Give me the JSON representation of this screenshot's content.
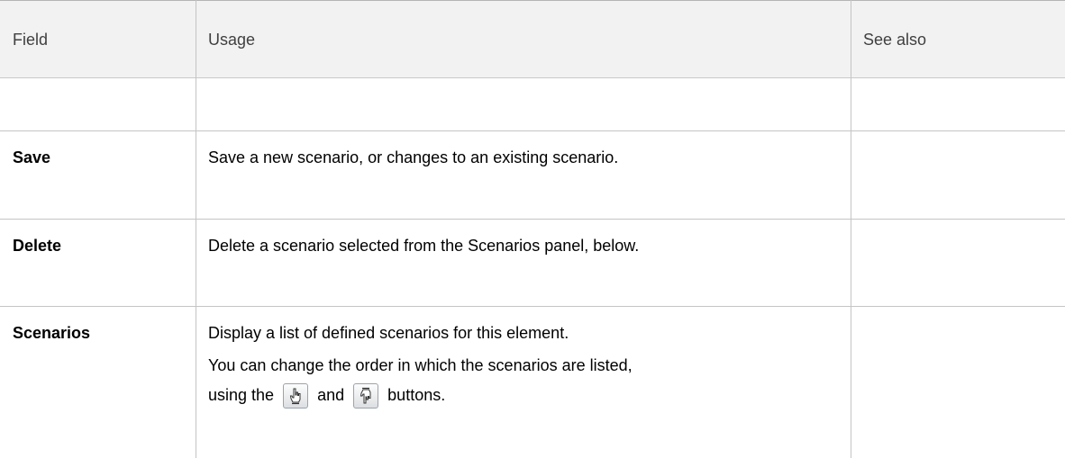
{
  "table": {
    "headers": {
      "field": "Field",
      "usage": "Usage",
      "see_also": "See also"
    },
    "rows": [
      {
        "field": "",
        "usage": ""
      },
      {
        "field": "Save",
        "usage": "Save a new scenario, or changes to an existing scenario."
      },
      {
        "field": "Delete",
        "usage": "Delete a scenario selected from the Scenarios panel, below."
      },
      {
        "field": "Scenarios",
        "usage": "Display a list of defined scenarios for this element.",
        "usage_2_line_1": "You can change the order in which the scenarios are listed,",
        "usage_2_pre": "using the",
        "usage_2_mid": "and",
        "usage_2_post": "buttons."
      }
    ]
  },
  "icons": {
    "move_up": "hand-pointing-up-icon",
    "move_down": "hand-pointing-down-icon"
  },
  "colors": {
    "header_bg": "#f2f2f2",
    "grid": "#c4c4c4",
    "header_text": "#404040"
  }
}
